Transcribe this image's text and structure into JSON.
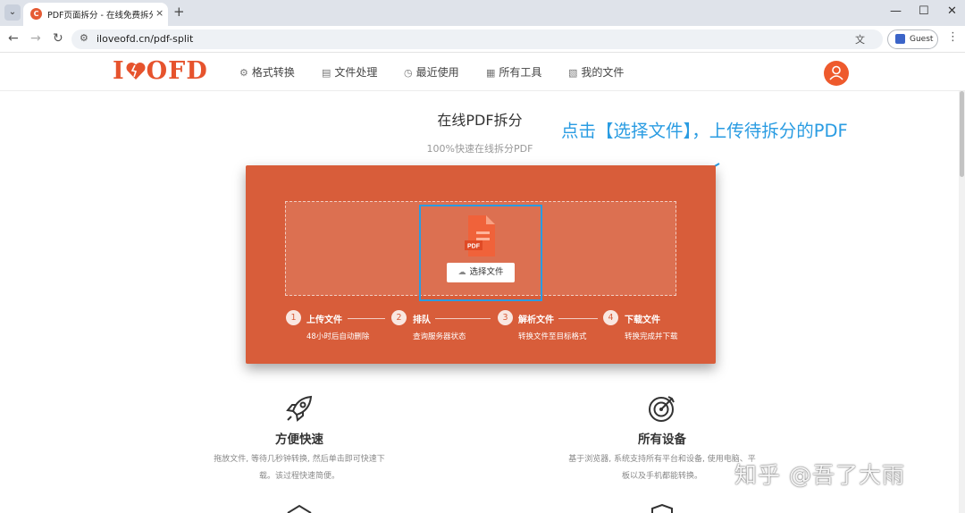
{
  "browser": {
    "tab_title": "PDF页面拆分 - 在线免费拆分PDF",
    "favicon_letter": "C",
    "tab_close": "×",
    "new_tab": "+",
    "url": "iloveofd.cn/pdf-split",
    "profile_label": "Guest"
  },
  "site": {
    "logo_left": "I",
    "logo_right": "OFD",
    "nav": [
      {
        "label": "格式转换",
        "icon": "format-convert-icon"
      },
      {
        "label": "文件处理",
        "icon": "file-process-icon"
      },
      {
        "label": "最近使用",
        "icon": "recent-icon"
      },
      {
        "label": "所有工具",
        "icon": "all-tools-icon"
      },
      {
        "label": "我的文件",
        "icon": "my-files-icon"
      }
    ]
  },
  "hero": {
    "title": "在线PDF拆分",
    "subtitle": "100%快速在线拆分PDF",
    "annotation": "点击【选择文件】，上传待拆分的PDF",
    "pdf_badge": "PDF",
    "choose_button": "选择文件"
  },
  "steps": [
    {
      "num": "1",
      "title": "上传文件",
      "desc": "48小时后自动删除"
    },
    {
      "num": "2",
      "title": "排队",
      "desc": "查询服务器状态"
    },
    {
      "num": "3",
      "title": "解析文件",
      "desc": "转换文件至目标格式"
    },
    {
      "num": "4",
      "title": "下载文件",
      "desc": "转换完成并下载"
    }
  ],
  "features": [
    {
      "title": "方便快速",
      "line1": "拖放文件, 等待几秒钟转换, 然后单击即可快速下",
      "line2": "载。该过程快速简便。",
      "icon": "rocket-icon"
    },
    {
      "title": "所有设备",
      "line1": "基于浏览器, 系统支持所有平台和设备, 使用电脑、平",
      "line2": "板以及手机都能转换。",
      "icon": "target-icon"
    }
  ],
  "watermark": "知乎 @吾了大雨",
  "colors": {
    "brand": "#e6532d",
    "card": "#d85d3a",
    "annotation": "#2a9ce2"
  }
}
